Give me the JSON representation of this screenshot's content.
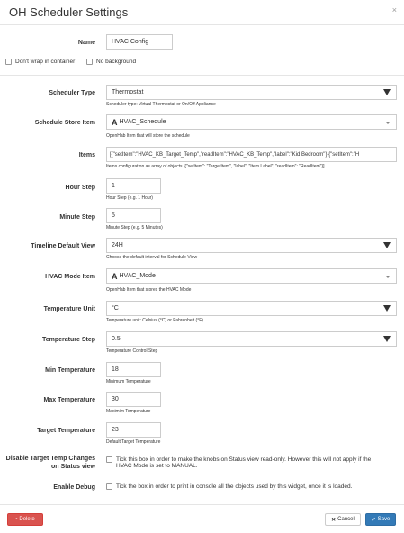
{
  "dialog": {
    "title": "OH Scheduler Settings",
    "close_glyph": "×"
  },
  "fields": {
    "name": {
      "label": "Name",
      "value": "HVAC Config"
    },
    "no_wrap": {
      "label": "Don't wrap in container"
    },
    "no_background": {
      "label": "No background"
    },
    "scheduler_type": {
      "label": "Scheduler Type",
      "value": "Thermostat",
      "help": "Scheduler type: Virtual Thermostat or On/Off Appliance"
    },
    "schedule_store_item": {
      "label": "Schedule Store Item",
      "type_glyph": "A",
      "value": "HVAC_Schedule",
      "help": "OpenHab Item that will store the schedule"
    },
    "items": {
      "label": "Items",
      "value": "[{\"setItem\":\"HVAC_KB_Target_Temp\",\"readItem\":\"HVAC_KB_Temp\",\"label\":\"Kid Bedroom\"},{\"setItem\":\"H",
      "help": "Items configuration as array of objects [{\"setItem\": \"TargetItem\", \"label\": \"Item Label\", \"readItem\": \"ReadItem\"}]"
    },
    "hour_step": {
      "label": "Hour Step",
      "value": "1",
      "help": "Hour Step (e.g. 1 Hour)"
    },
    "minute_step": {
      "label": "Minute Step",
      "value": "5",
      "help": "Minute Step (e.g. 5 Minutes)"
    },
    "timeline_default_view": {
      "label": "Timeline Default View",
      "value": "24H",
      "help": "Choose the default interval for Schedule View"
    },
    "hvac_mode_item": {
      "label": "HVAC Mode Item",
      "type_glyph": "A",
      "value": "HVAC_Mode",
      "help": "OpenHab Item that stores the HVAC Mode"
    },
    "temperature_unit": {
      "label": "Temperature Unit",
      "value": "°C",
      "help": "Temperature unit: Celsius (°C) or Fahrenheit (°F)"
    },
    "temperature_step": {
      "label": "Temperature Step",
      "value": "0.5",
      "help": "Temperature Control Step"
    },
    "min_temperature": {
      "label": "Min Temperature",
      "value": "18",
      "help": "Minimum Temperature"
    },
    "max_temperature": {
      "label": "Max Temperature",
      "value": "30",
      "help": "Maximim Temperature"
    },
    "target_temperature": {
      "label": "Target Temperature",
      "value": "23",
      "help": "Default Target Temperature"
    },
    "disable_target_temp": {
      "label_line1": "Disable Target Temp Changes",
      "label_line2": "on Status view",
      "text_line1": "Tick this box in order to make the knobs on Status view read-only. However this will not apply if the",
      "text_line2": "HVAC Mode is set to MANUAL."
    },
    "enable_debug": {
      "label": "Enable Debug",
      "text": "Tick the box in order to print in console all the objects used by this widget, once it is loaded."
    }
  },
  "footer": {
    "delete_label": "Delete",
    "cancel_label": "Cancel",
    "save_label": "Save"
  },
  "colors": {
    "delete": "#d9534f",
    "save": "#337ab7"
  }
}
